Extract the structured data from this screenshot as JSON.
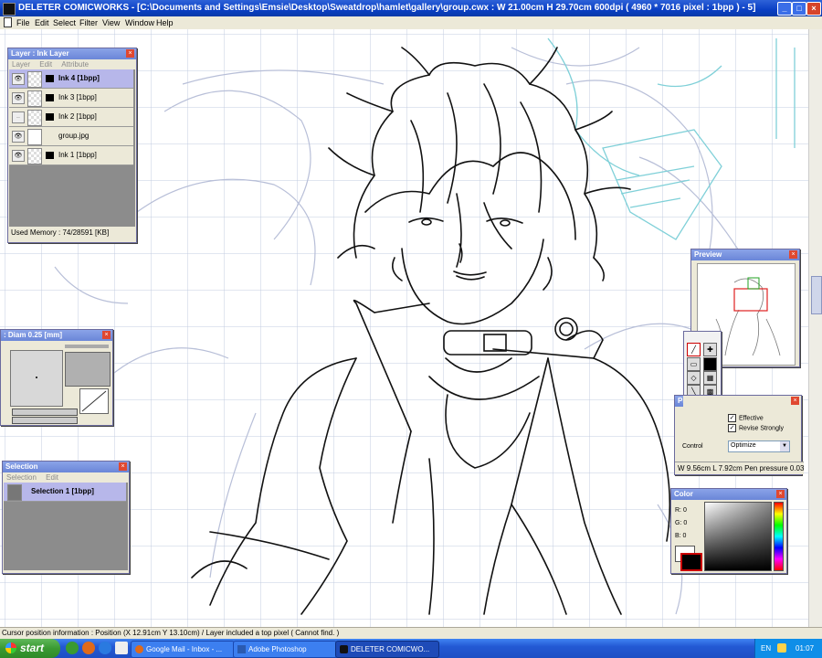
{
  "window": {
    "title": "DELETER COMICWORKS - [C:\\Documents and Settings\\Emsie\\Desktop\\Sweatdrop\\hamlet\\gallery\\group.cwx : W 21.00cm H 29.70cm 600dpi ( 4960 * 7016 pixel : 1bpp ) - 5]",
    "menu": [
      "File",
      "Edit",
      "Select",
      "Filter",
      "View",
      "Window",
      "Help"
    ]
  },
  "layer_palette": {
    "title": "Layer : Ink Layer",
    "tabs": [
      "Layer",
      "Edit",
      "Attribute"
    ],
    "layers": [
      {
        "name": "Ink 4 [1bpp]",
        "selected": true
      },
      {
        "name": "Ink 3 [1bpp]",
        "selected": false
      },
      {
        "name": "Ink 2 [1bpp]",
        "selected": false
      },
      {
        "name": "group.jpg",
        "selected": false
      },
      {
        "name": "Ink 1 [1bpp]",
        "selected": false
      }
    ],
    "memory": "Used Memory : 74/28591 [KB]"
  },
  "brush_palette": {
    "title": ": Diam 0.25 [mm]"
  },
  "selection_palette": {
    "title": "Selection",
    "tabs": [
      "Selection",
      "Edit"
    ],
    "item": "Selection 1 [1bpp]"
  },
  "preview_palette": {
    "title": "Preview"
  },
  "pen_palette": {
    "title": "Pr",
    "effective_label": "Effective",
    "revise_label": "Revise Strongly",
    "control_label": "Control",
    "optimize_value": "Optimize",
    "readout": "W 9.56cm L 7.92cm  Pen pressure 0.03"
  },
  "color_palette": {
    "title": "Color",
    "r_label": "R: 0",
    "g_label": "G: 0",
    "b_label": "B: 0"
  },
  "status_bar": "Cursor position information : Position (X 12.91cm Y 13.10cm) / Layer included a top pixel ( Cannot find. )",
  "taskbar": {
    "start": "start",
    "buttons": [
      "Google Mail - Inbox - ...",
      "Adobe Photoshop",
      "DELETER COMICWO..."
    ],
    "language": "EN",
    "clock": "01:07"
  },
  "colors": {
    "titlebar": "#0a3fc4",
    "palette_header": "#7a94e0",
    "selected_layer": "#b7b7ea",
    "guide_lines": "#b9c4dc"
  }
}
